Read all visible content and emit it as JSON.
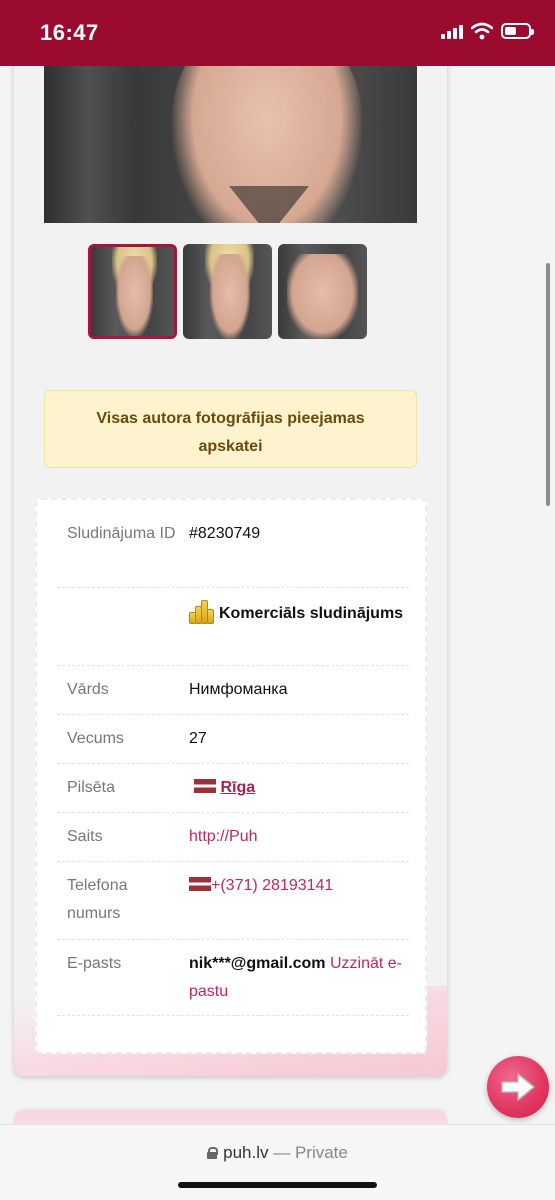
{
  "status_bar": {
    "time": "16:47",
    "icons": [
      "signal-icon",
      "wifi-icon",
      "battery-icon"
    ]
  },
  "gallery": {
    "thumbnail_count": 3,
    "active_index": 0
  },
  "notice": {
    "text": "Visas autora fotogrāfijas pieejamas apskatei"
  },
  "details": {
    "rows": [
      {
        "label": "Sludinājuma ID",
        "value": "#8230749"
      },
      {
        "label": "",
        "value": "Komerciāls sludinājums",
        "icon": "coins-icon"
      },
      {
        "label": "Vārds",
        "value": "Нимфоманка"
      },
      {
        "label": "Vecums",
        "value": "27"
      },
      {
        "label": "Pilsēta",
        "value": "Rīga",
        "icon": "latvia-flag-icon"
      },
      {
        "label": "Saits",
        "value": "http://Puh"
      },
      {
        "label": "Telefona numurs",
        "value": "+(371) 28193141",
        "icon": "latvia-flag-icon"
      },
      {
        "label": "E-pasts",
        "value": "nik***@gmail.com",
        "action": "Uzzināt e-pastu"
      }
    ]
  },
  "browser": {
    "domain": "puh.lv",
    "separator": "—",
    "mode": "Private"
  },
  "colors": {
    "status_bar": "#9b0b2f",
    "accent": "#c0285a",
    "notice_bg": "#fdf3cf",
    "notice_text": "#6b4a0a"
  }
}
